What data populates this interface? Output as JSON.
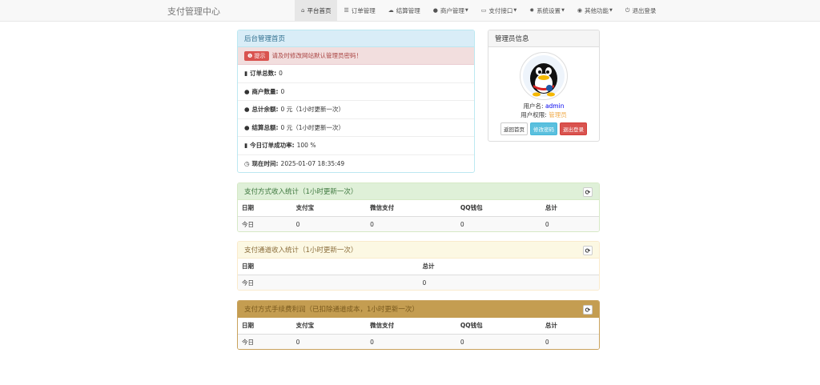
{
  "brand": "支付管理中心",
  "nav": [
    {
      "icon": "⌂",
      "label": "平台首页",
      "caret": false
    },
    {
      "icon": "☰",
      "label": "订单管理",
      "caret": false
    },
    {
      "icon": "☁",
      "label": "结算管理",
      "caret": false
    },
    {
      "icon": "●",
      "label": "商户管理",
      "caret": true
    },
    {
      "icon": "▭",
      "label": "支付接口",
      "caret": true
    },
    {
      "icon": "✹",
      "label": "系统设置",
      "caret": true
    },
    {
      "icon": "◉",
      "label": "其他功能",
      "caret": true
    },
    {
      "icon": "⏻",
      "label": "退出登录",
      "caret": false
    }
  ],
  "main_panel": {
    "title": "后台管理首页",
    "alert_badge": "提示",
    "alert_text": "请及时修改网站默认管理员密码！",
    "items": [
      {
        "icon": "▮",
        "label": "订单总数:",
        "value": "0"
      },
      {
        "icon": "●",
        "label": "商户数量:",
        "value": "0"
      },
      {
        "icon": "●",
        "label": "总计余额:",
        "value": "0 元（1小时更新一次）"
      },
      {
        "icon": "●",
        "label": "结算总额:",
        "value": "0 元（1小时更新一次）"
      },
      {
        "icon": "▮",
        "label": "今日订单成功率:",
        "value": "100 %"
      },
      {
        "icon": "◷",
        "label": "现在时间:",
        "value": "2025-01-07 18:35:49"
      }
    ]
  },
  "admin_panel": {
    "title": "管理员信息",
    "username_label": "用户名:",
    "username": "admin",
    "role_label": "用户权限:",
    "role": "管理员",
    "btn_home": "返回首页",
    "btn_password": "修改密码",
    "btn_logout": "退出登录"
  },
  "pay_stats": {
    "title": "支付方式收入统计（1小时更新一次）",
    "headers": [
      "日期",
      "支付宝",
      "微信支付",
      "QQ钱包",
      "总计"
    ],
    "row": [
      "今日",
      "0",
      "0",
      "0",
      "0"
    ]
  },
  "channel_stats": {
    "title": "支付通道收入统计（1小时更新一次）",
    "headers": [
      "日期",
      "总计"
    ],
    "row": [
      "今日",
      "0"
    ]
  },
  "fee_stats": {
    "title": "支付方式手续费利润（已扣除通道成本，1小时更新一次）",
    "headers": [
      "日期",
      "支付宝",
      "微信支付",
      "QQ钱包",
      "总计"
    ],
    "row": [
      "今日",
      "0",
      "0",
      "0",
      "0"
    ]
  },
  "refresh_icon": "⟳",
  "colors": {
    "link": "#0000ee",
    "role": "#f0ad4e"
  }
}
